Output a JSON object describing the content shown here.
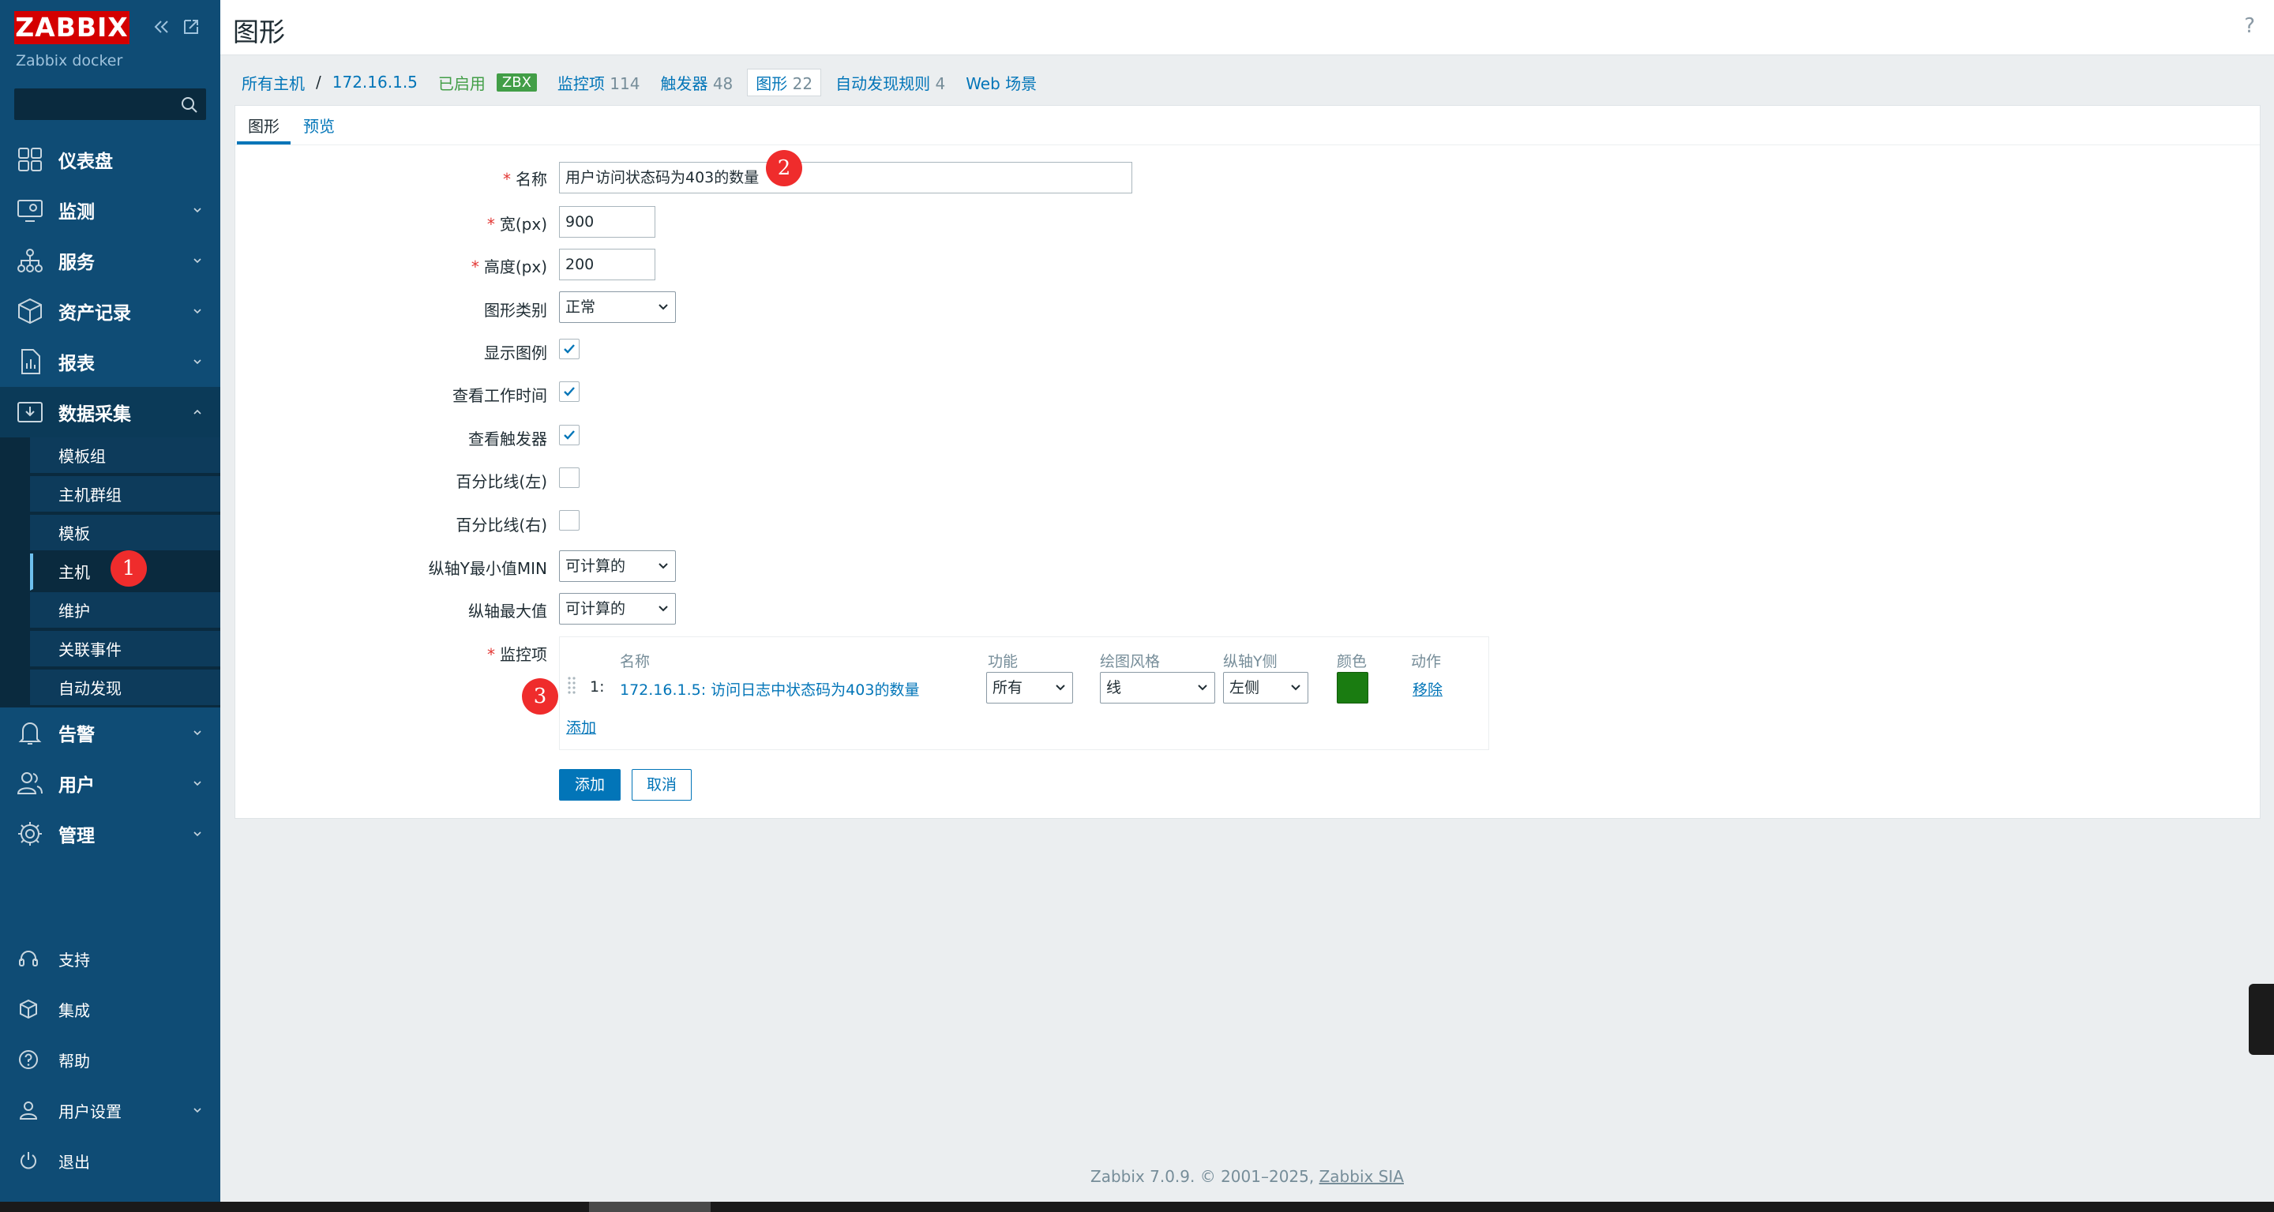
{
  "sidebar": {
    "logo": "ZABBIX",
    "subtitle": "Zabbix docker",
    "search_placeholder": "",
    "menu": [
      {
        "label": "仪表盘",
        "icon": "dashboard-icon"
      },
      {
        "label": "监测",
        "icon": "monitoring-icon"
      },
      {
        "label": "服务",
        "icon": "services-icon"
      },
      {
        "label": "资产记录",
        "icon": "inventory-icon"
      },
      {
        "label": "报表",
        "icon": "reports-icon"
      },
      {
        "label": "数据采集",
        "icon": "data-collection-icon"
      }
    ],
    "submenu": [
      "模板组",
      "主机群组",
      "模板",
      "主机",
      "维护",
      "关联事件",
      "自动发现"
    ],
    "menu2": [
      {
        "label": "告警",
        "icon": "alerts-icon"
      },
      {
        "label": "用户",
        "icon": "users-icon"
      },
      {
        "label": "管理",
        "icon": "administration-icon"
      }
    ],
    "bottom": [
      {
        "label": "支持",
        "icon": "support-icon"
      },
      {
        "label": "集成",
        "icon": "integrations-icon"
      },
      {
        "label": "帮助",
        "icon": "help-icon"
      },
      {
        "label": "用户设置",
        "icon": "user-settings-icon"
      },
      {
        "label": "退出",
        "icon": "signout-icon"
      }
    ]
  },
  "header": {
    "title": "图形",
    "help": "?"
  },
  "breadcrumb": {
    "all_hosts": "所有主机",
    "sep": "/",
    "host": "172.16.1.5",
    "enabled": "已启用",
    "zbx": "ZBX",
    "items_label": "监控项",
    "items_count": "114",
    "triggers_label": "触发器",
    "triggers_count": "48",
    "graphs_label": "图形",
    "graphs_count": "22",
    "discovery_label": "自动发现规则",
    "discovery_count": "4",
    "web_label": "Web 场景"
  },
  "tabs": {
    "graph": "图形",
    "preview": "预览"
  },
  "form": {
    "name_label": "名称",
    "name_value": "用户访问状态码为403的数量",
    "width_label": "宽(px)",
    "width_value": "900",
    "height_label": "高度(px)",
    "height_value": "200",
    "graph_type_label": "图形类别",
    "graph_type_value": "正常",
    "show_legend_label": "显示图例",
    "show_legend": true,
    "show_worktime_label": "查看工作时间",
    "show_worktime": true,
    "show_triggers_label": "查看触发器",
    "show_triggers": true,
    "percent_left_label": "百分比线(左)",
    "percent_left": false,
    "percent_right_label": "百分比线(右)",
    "percent_right": false,
    "ymin_label": "纵轴Y最小值MIN",
    "ymin_value": "可计算的",
    "ymax_label": "纵轴最大值",
    "ymax_value": "可计算的",
    "items_label": "监控项",
    "items_columns": {
      "name": "名称",
      "function": "功能",
      "draw_style": "绘图风格",
      "y_axis": "纵轴Y侧",
      "color": "颜色",
      "action": "动作"
    },
    "items": [
      {
        "index": "1:",
        "name": "172.16.1.5: 访问日志中状态码为403的数量",
        "function": "所有",
        "draw_style": "线",
        "y_axis": "左侧",
        "color": "#1a7c11",
        "action": "移除"
      }
    ],
    "add_item": "添加",
    "add_button": "添加",
    "cancel_button": "取消"
  },
  "badges": {
    "b1": "1",
    "b2": "2",
    "b3": "3"
  },
  "footer": {
    "text": "Zabbix 7.0.9. © 2001–2025,",
    "link": "Zabbix SIA"
  }
}
